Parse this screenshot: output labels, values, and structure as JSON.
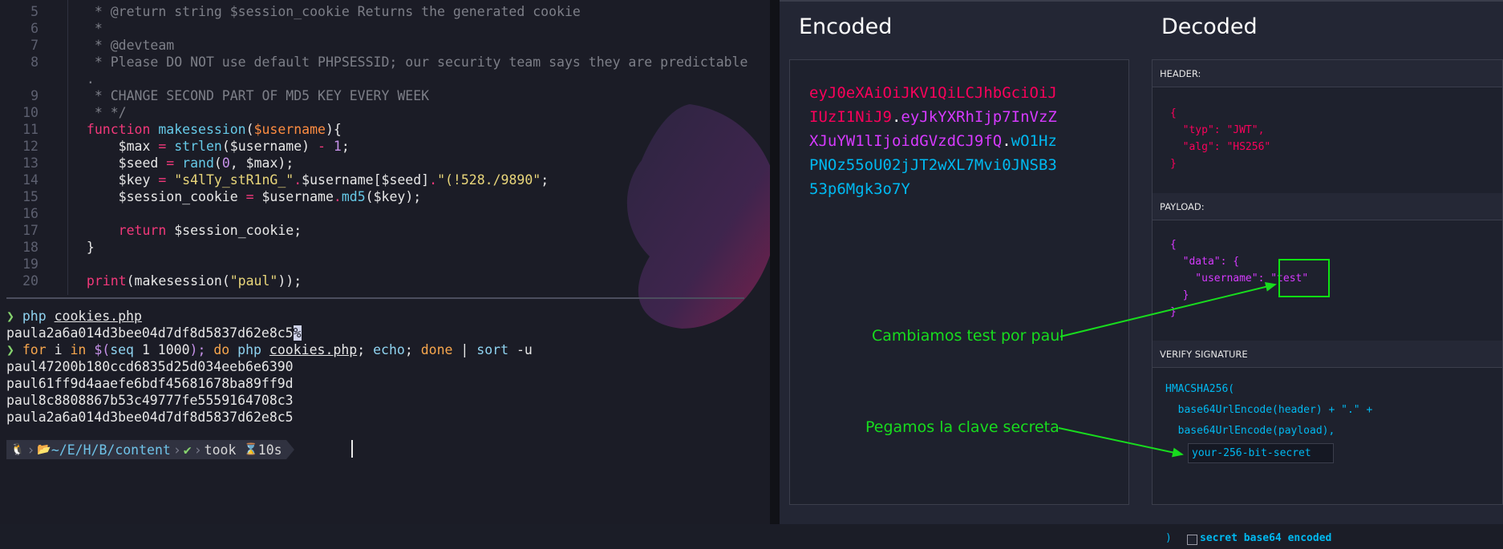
{
  "editor": {
    "lines": [
      {
        "n": "5",
        "parts": [
          [
            "cm",
            "  * @return string $session_cookie Returns the generated cookie"
          ]
        ]
      },
      {
        "n": "6",
        "parts": [
          [
            "cm",
            "  *"
          ]
        ]
      },
      {
        "n": "7",
        "parts": [
          [
            "cm",
            "  * @devteam"
          ]
        ]
      },
      {
        "n": "8",
        "parts": [
          [
            "cm",
            "  * Please DO NOT use default PHPSESSID; our security team says they are predictable"
          ]
        ]
      },
      {
        "n": "",
        "parts": [
          [
            "cm",
            " ."
          ]
        ]
      },
      {
        "n": "9",
        "parts": [
          [
            "cm",
            "  * CHANGE SECOND PART OF MD5 KEY EVERY WEEK"
          ]
        ]
      },
      {
        "n": "10",
        "parts": [
          [
            "cm",
            "  * */"
          ]
        ]
      },
      {
        "n": "11",
        "parts": [
          [
            "kw",
            " function "
          ],
          [
            "fn",
            "makesession"
          ],
          [
            "var",
            "("
          ],
          [
            "varo",
            "$username"
          ],
          [
            "var",
            "){"
          ]
        ]
      },
      {
        "n": "12",
        "parts": [
          [
            "var",
            "     $max "
          ],
          [
            "kw",
            "= "
          ],
          [
            "fn",
            "strlen"
          ],
          [
            "var",
            "($username) "
          ],
          [
            "kw",
            "- "
          ],
          [
            "num",
            "1"
          ],
          [
            "var",
            ";"
          ]
        ]
      },
      {
        "n": "13",
        "parts": [
          [
            "var",
            "     $seed "
          ],
          [
            "kw",
            "= "
          ],
          [
            "fn",
            "rand"
          ],
          [
            "var",
            "("
          ],
          [
            "num",
            "0"
          ],
          [
            "var",
            ", $max);"
          ]
        ]
      },
      {
        "n": "14",
        "parts": [
          [
            "var",
            "     $key "
          ],
          [
            "kw",
            "= "
          ],
          [
            "str",
            "\"s4lTy_stR1nG_\""
          ],
          [
            "kw",
            "."
          ],
          [
            "var",
            "$username[$seed]"
          ],
          [
            "kw",
            "."
          ],
          [
            "str",
            "\"(!528./9890\""
          ],
          [
            "var",
            ";"
          ]
        ]
      },
      {
        "n": "15",
        "parts": [
          [
            "var",
            "     $session_cookie "
          ],
          [
            "kw",
            "= "
          ],
          [
            "var",
            "$username"
          ],
          [
            "kw",
            "."
          ],
          [
            "fn",
            "md5"
          ],
          [
            "var",
            "($key);"
          ]
        ]
      },
      {
        "n": "16",
        "parts": [
          [
            "var",
            ""
          ]
        ]
      },
      {
        "n": "17",
        "parts": [
          [
            "kw",
            "     return "
          ],
          [
            "var",
            "$session_cookie;"
          ]
        ]
      },
      {
        "n": "18",
        "parts": [
          [
            "var",
            " }"
          ]
        ]
      },
      {
        "n": "19",
        "parts": [
          [
            "var",
            ""
          ]
        ]
      },
      {
        "n": "20",
        "parts": [
          [
            "kw",
            " print"
          ],
          [
            "var",
            "(makesession("
          ],
          [
            "str",
            "\"paul\""
          ],
          [
            "var",
            "));"
          ]
        ]
      }
    ]
  },
  "terminal": {
    "cmd1_prompt": "❯",
    "cmd1_bin": "php",
    "cmd1_file": "cookies.php",
    "out1_text": "paula2a6a014d3bee04d7df8d5837d62e8c5",
    "out1_cursor": "%",
    "cmd2_prompt": "❯",
    "cmd2_for": "for",
    "cmd2_i": "i",
    "cmd2_in": "in",
    "cmd2_sub_open": "$(",
    "cmd2_seq": "seq",
    "cmd2_seq_args": "1 1000",
    "cmd2_sub_close": ");",
    "cmd2_do": "do",
    "cmd2_php": "php",
    "cmd2_file": "cookies.php",
    "cmd2_semi1": ";",
    "cmd2_echo": "echo",
    "cmd2_semi2": ";",
    "cmd2_done": "done",
    "cmd2_pipe": "|",
    "cmd2_sort": "sort",
    "cmd2_sort_arg": "-u",
    "outputs": [
      "paul47200b180ccd6835d25d034eeb6e6390",
      "paul61ff9d4aaefe6bdf45681678ba89ff9d",
      "paul8c8808867b53c49777fe5559164708c3",
      "paula2a6a014d3bee04d7df8d5837d62e8c5"
    ],
    "prompt_bar": {
      "os_icon": "🐧",
      "folder_icon": "📂",
      "path_home": "~",
      "path_parts": [
        "E",
        "H",
        "B"
      ],
      "path_last": "content",
      "status": "✔",
      "took_label": "took",
      "hourglass_icon": "⌛",
      "took_time": "10s"
    }
  },
  "jwt": {
    "encoded_title": "Encoded",
    "decoded_title": "Decoded",
    "token_header": "eyJ0eXAiOiJKV1QiLCJhbGciOiJIUzI1NiJ9",
    "token_payload": "eyJkYXRhIjp7InVzZXJuYW1lIjoidGVzdCJ9fQ",
    "token_signature": "wO1HzPNOz55oU02jJT2wXL7Mvi0JNSB353p6Mgk3o7Y",
    "dot": ".",
    "header_label": "HEADER:",
    "header_json": "{\n  \"typ\": \"JWT\",\n  \"alg\": \"HS256\"\n}",
    "payload_label": "PAYLOAD:",
    "payload_line1": "{",
    "payload_line2": "  \"data\": {",
    "payload_line3_key": "    \"username\": ",
    "payload_line3_val": "\"test\"",
    "payload_line4": "  }",
    "payload_line5": "}",
    "verify_label": "VERIFY SIGNATURE",
    "verify_line1": "HMACSHA256(",
    "verify_line2": "  base64UrlEncode(header) + \".\" +",
    "verify_line3": "  base64UrlEncode(payload),",
    "verify_close": ")",
    "secret_value": "your-256-bit-secret",
    "checkbox_label": "secret base64 encoded",
    "checkbox_checked": false
  },
  "annotations": {
    "payload_note": "Cambiamos test por paul",
    "secret_note": "Pegamos la clave secreta",
    "color": "#18dc1e"
  }
}
